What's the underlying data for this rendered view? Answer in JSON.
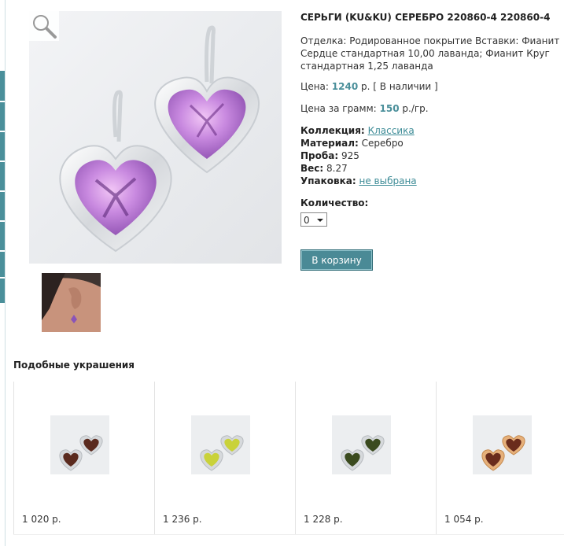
{
  "product": {
    "title": "СЕРЬГИ (KU&KU) СЕРЕБРО 220860-4 220860-4",
    "description": "Отделка: Родированное покрытие Вставки: Фианит Сердце стандартная 10,00 лаванда; Фианит Круг стандартная 1,25 лаванда",
    "price_label": "Цена:",
    "price_value": "1240",
    "price_currency": "р.",
    "availability": "[ В наличии ]",
    "per_gram_label": "Цена за грамм:",
    "per_gram_value": "150",
    "per_gram_unit": "р./гр.",
    "collection_label": "Коллекция:",
    "collection_value": "Классика",
    "material_label": "Материал:",
    "material_value": "Серебро",
    "proba_label": "Проба:",
    "proba_value": "925",
    "weight_label": "Вес:",
    "weight_value": "8.27",
    "packaging_label": "Упаковка:",
    "packaging_value": "не выбрана",
    "quantity_label": "Количество:",
    "quantity_value": "0",
    "cart_button": "В корзину"
  },
  "similar": {
    "heading": "Подобные украшения",
    "items": [
      {
        "price": "1 020 р.",
        "stone": "#5a2a1e",
        "metal": "silver"
      },
      {
        "price": "1 236 р.",
        "stone": "#c9d23a",
        "metal": "silver"
      },
      {
        "price": "1 228 р.",
        "stone": "#3a4a1e",
        "metal": "silver"
      },
      {
        "price": "1 054 р.",
        "stone": "#6a2c1c",
        "metal": "gold"
      }
    ]
  },
  "colors": {
    "accent": "#4a8f9a",
    "stone_main": "#c58be0"
  }
}
